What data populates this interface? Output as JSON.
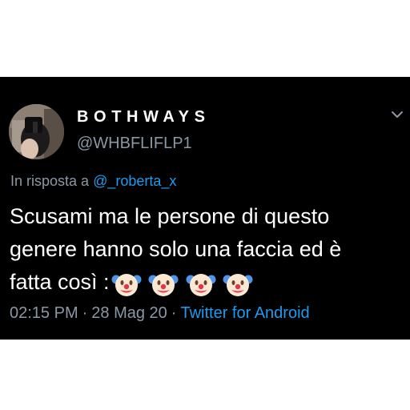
{
  "tweet": {
    "display_name": "BOTHWAYS",
    "handle": "@WHBFLIFLP1",
    "reply_prefix": "In risposta a",
    "reply_to": "@_roberta_x",
    "text_lines": [
      "Scusami ma le persone di questo",
      "genere hanno solo una faccia ed è",
      "fatta così :"
    ],
    "emojis": [
      "clown-face-icon",
      "clown-face-icon",
      "clown-face-icon",
      "clown-face-icon"
    ],
    "time": "02:15 PM",
    "separator": "·",
    "date": "28 Mag 20",
    "source": "Twitter for Android"
  },
  "colors": {
    "background": "#000000",
    "page": "#ffffff",
    "primary_text": "#ffffff",
    "secondary_text": "#8b98a5",
    "link": "#1d9bf0"
  }
}
